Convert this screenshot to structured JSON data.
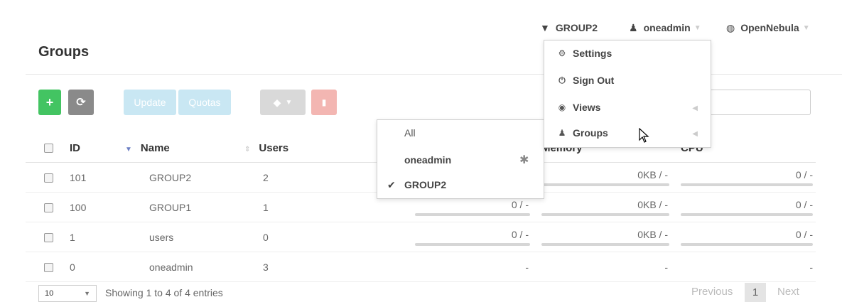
{
  "topnav": {
    "group_label": "GROUP2",
    "user_label": "oneadmin",
    "zone_label": "OpenNebula"
  },
  "page": {
    "title": "Groups"
  },
  "toolbar": {
    "create_label": "+",
    "refresh_label": "⟳",
    "update_label": "Update",
    "quotas_label": "Quotas",
    "labels_icon": "tag-icon",
    "delete_icon": "trash-icon"
  },
  "table": {
    "columns": [
      "ID",
      "Name",
      "Users",
      "Memory",
      "CPU"
    ],
    "rows": [
      {
        "id": "101",
        "name": "GROUP2",
        "users": "2",
        "vms": "",
        "memory": "0KB / -",
        "cpu": "0 / -"
      },
      {
        "id": "100",
        "name": "GROUP1",
        "users": "1",
        "vms": "0 / -",
        "memory": "0KB / -",
        "cpu": "0 / -"
      },
      {
        "id": "1",
        "name": "users",
        "users": "0",
        "vms": "0 / -",
        "memory": "0KB / -",
        "cpu": "0 / -"
      },
      {
        "id": "0",
        "name": "oneadmin",
        "users": "3",
        "vms": "-",
        "memory": "-",
        "cpu": "-"
      }
    ]
  },
  "user_menu": {
    "items": [
      "Settings",
      "Sign Out",
      "Views",
      "Groups"
    ]
  },
  "groups_submenu": {
    "items": [
      "All",
      "oneadmin",
      "GROUP2"
    ]
  },
  "footer": {
    "page_size": "10",
    "summary": "Showing 1 to 4 of 4 entries",
    "previous_label": "Previous",
    "page_number": "1",
    "next_label": "Next"
  },
  "colors": {
    "create_button": "#43c462",
    "refresh_button": "#8a8a8a",
    "update_button": "#c9e7f3",
    "labels_button": "#d9d9d9",
    "delete_button": "#f3b6b2"
  }
}
